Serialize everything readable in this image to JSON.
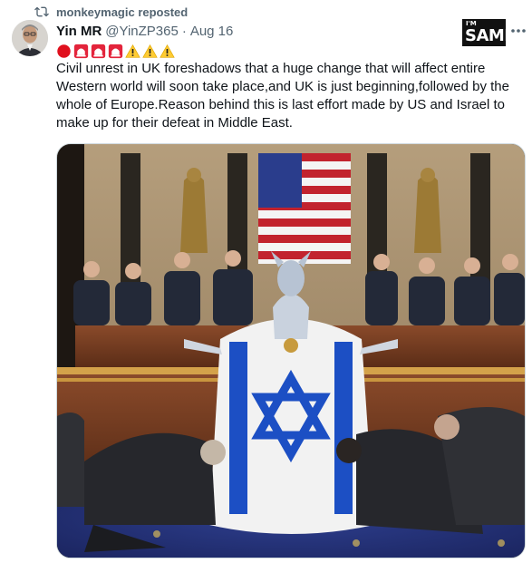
{
  "repost": {
    "icon": "repost-icon",
    "text": "monkeymagic reposted"
  },
  "author": {
    "name": "Yin MR",
    "handle": "@YinZP365",
    "separator": "·",
    "date": "Aug 16",
    "avatar_icon": "avatar"
  },
  "badge": {
    "line1": "I'M",
    "line2": "SAMI"
  },
  "more_icon": "more-options-icon",
  "emojis": [
    "red-circle",
    "siren",
    "siren",
    "siren",
    "warning",
    "warning",
    "warning"
  ],
  "tweet": {
    "text": "Civil unrest in UK foreshadows that a huge change that will affect entire Western world will soon take place,and UK is just beginning,followed by the whole of Europe.Reason behind this is last effort made by US and Israel to make up for their defeat in Middle East."
  },
  "media": {
    "description_icon": "attached-image"
  },
  "colors": {
    "secondary_text": "#536471",
    "primary_text": "#0f1419",
    "border": "#cfd9de",
    "flag_blue": "#1c4fc4"
  }
}
